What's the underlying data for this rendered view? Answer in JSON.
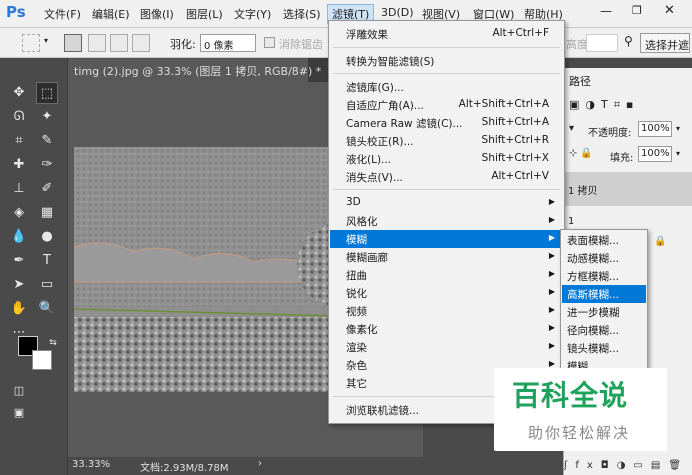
{
  "app": {
    "logo": "Ps"
  },
  "menubar": {
    "items": [
      "文件(F)",
      "编辑(E)",
      "图像(I)",
      "图层(L)",
      "文字(Y)",
      "选择(S)",
      "滤镜(T)",
      "3D(D)",
      "视图(V)",
      "窗口(W)",
      "帮助(H)"
    ],
    "active": "滤镜(T)"
  },
  "options": {
    "feather_label": "羽化:",
    "feather_value": "0 像素",
    "antialias_label": "消除锯齿",
    "height_label": "高度:",
    "select_mask_label": "选择并遮"
  },
  "document": {
    "tab_title": "timg (2).jpg @ 33.3% (图层 1 拷贝, RGB/8#) *",
    "zoom": "33.33%",
    "doc_size": "文档:2.93M/8.78M"
  },
  "layers_panel": {
    "tab_label": "路径",
    "opacity_label": "不透明度:",
    "opacity_value": "100%",
    "fill_label": "填充:",
    "fill_value": "100%",
    "layer1_name": "1 拷贝",
    "layer2_name": "1"
  },
  "filter_menu": {
    "items": [
      {
        "label": "浮雕效果",
        "shortcut": "Alt+Ctrl+F"
      },
      {
        "label": "转换为智能滤镜(S)",
        "shortcut": ""
      },
      {
        "label": "滤镜库(G)...",
        "shortcut": ""
      },
      {
        "label": "自适应广角(A)...",
        "shortcut": "Alt+Shift+Ctrl+A"
      },
      {
        "label": "Camera Raw 滤镜(C)...",
        "shortcut": "Shift+Ctrl+A"
      },
      {
        "label": "镜头校正(R)...",
        "shortcut": "Shift+Ctrl+R"
      },
      {
        "label": "液化(L)...",
        "shortcut": "Shift+Ctrl+X"
      },
      {
        "label": "消失点(V)...",
        "shortcut": "Alt+Ctrl+V"
      },
      {
        "label": "3D",
        "shortcut": ""
      },
      {
        "label": "风格化",
        "shortcut": ""
      },
      {
        "label": "模糊",
        "shortcut": ""
      },
      {
        "label": "模糊画廊",
        "shortcut": ""
      },
      {
        "label": "扭曲",
        "shortcut": ""
      },
      {
        "label": "锐化",
        "shortcut": ""
      },
      {
        "label": "视频",
        "shortcut": ""
      },
      {
        "label": "像素化",
        "shortcut": ""
      },
      {
        "label": "渲染",
        "shortcut": ""
      },
      {
        "label": "杂色",
        "shortcut": ""
      },
      {
        "label": "其它",
        "shortcut": ""
      },
      {
        "label": "浏览联机滤镜...",
        "shortcut": ""
      }
    ],
    "highlighted": "模糊"
  },
  "blur_submenu": {
    "items": [
      "表面模糊...",
      "动感模糊...",
      "方框模糊...",
      "高斯模糊...",
      "进一步模糊",
      "径向模糊...",
      "镜头模糊...",
      "模糊"
    ],
    "highlighted": "高斯模糊..."
  },
  "watermark": {
    "title": "百科全说",
    "subtitle": "助你轻松解决"
  },
  "colors": {
    "menu_highlight": "#0078d7",
    "watermark_green": "#1fa25c",
    "ps_blue": "#2d7ad6"
  }
}
